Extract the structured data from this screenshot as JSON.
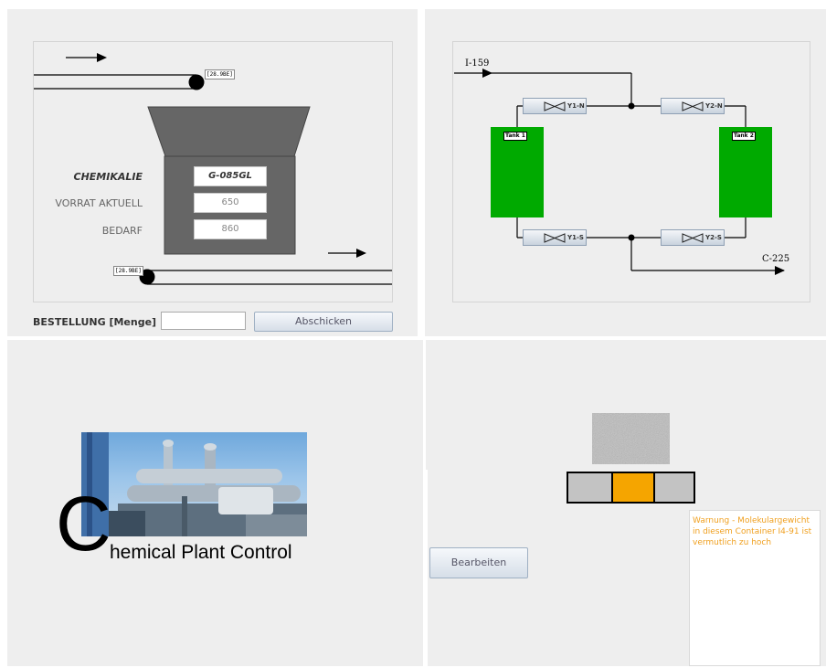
{
  "top_left": {
    "pipe_tag_top": "[28.9BE]",
    "pipe_tag_bottom": "[28.9BE]",
    "fields": [
      {
        "label": "CHEMIKALIE",
        "value": "G-085GL"
      },
      {
        "label": "VORRAT AKTUELL",
        "value": "650"
      },
      {
        "label": "BEDARF",
        "value": "860"
      }
    ],
    "order_label": "BESTELLUNG [Menge]",
    "order_value": "",
    "submit_label": "Abschicken"
  },
  "top_right": {
    "input_line": "I-159",
    "output_line": "C-225",
    "tank1": "Tank 1",
    "tank2": "Tank 2",
    "tank_color": "#00aa00",
    "valves": [
      "Y1-N",
      "Y2-N",
      "Y1-S",
      "Y2-S"
    ]
  },
  "bottom_left": {
    "logo_letter": "C",
    "logo_text": "hemical Plant Control"
  },
  "bottom_right": {
    "edit_label": "Bearbeiten",
    "indicator_color": "#f5a500",
    "warning_text": "Warnung - Molekulargewicht in diesem Container I4-91 ist vermutlich zu hoch",
    "warning_color": "#f0a020"
  }
}
